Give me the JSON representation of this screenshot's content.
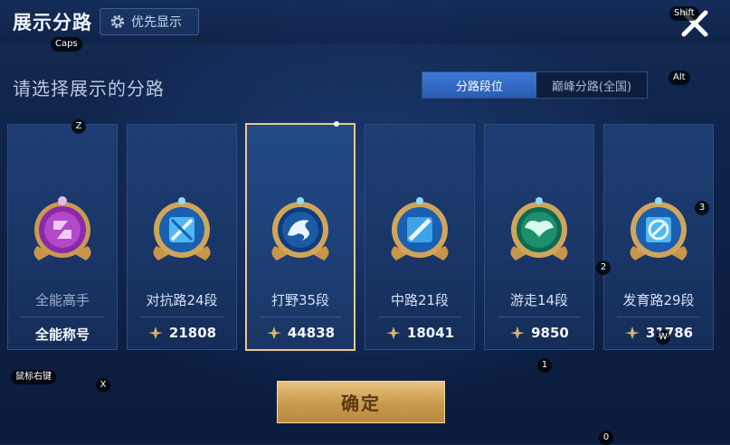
{
  "header": {
    "title": "展示分路",
    "pref_button": "优先显示"
  },
  "subtitle": "请选择展示的分路",
  "tabs": [
    {
      "label": "分路段位",
      "active": true
    },
    {
      "label": "巅峰分路(全国)",
      "active": false
    }
  ],
  "cards": [
    {
      "name": "全能高手",
      "score": "全能称号",
      "has_icon": false,
      "emblem": "allround-emblem-icon",
      "selected": false
    },
    {
      "name": "对抗路24段",
      "score": "21808",
      "has_icon": true,
      "emblem": "clash-lane-emblem-icon",
      "selected": false
    },
    {
      "name": "打野35段",
      "score": "44838",
      "has_icon": true,
      "emblem": "jungle-emblem-icon",
      "selected": true
    },
    {
      "name": "中路21段",
      "score": "18041",
      "has_icon": true,
      "emblem": "mid-lane-emblem-icon",
      "selected": false
    },
    {
      "name": "游走14段",
      "score": "9850",
      "has_icon": true,
      "emblem": "roam-emblem-icon",
      "selected": false
    },
    {
      "name": "发育路29段",
      "score": "31786",
      "has_icon": true,
      "emblem": "farm-lane-emblem-icon",
      "selected": false
    }
  ],
  "confirm": "确定",
  "key_hints": {
    "shift": "Shift",
    "caps": "Caps",
    "alt": "Alt",
    "z": "Z",
    "x": "X",
    "k3": "3",
    "k2": "2",
    "k1": "1",
    "k0": "0",
    "w": "W",
    "mouse": "鼠标右键"
  },
  "colors": {
    "accent": "#e9c98a",
    "tab_active": "#3d7ad6",
    "background": "#0e2248"
  }
}
